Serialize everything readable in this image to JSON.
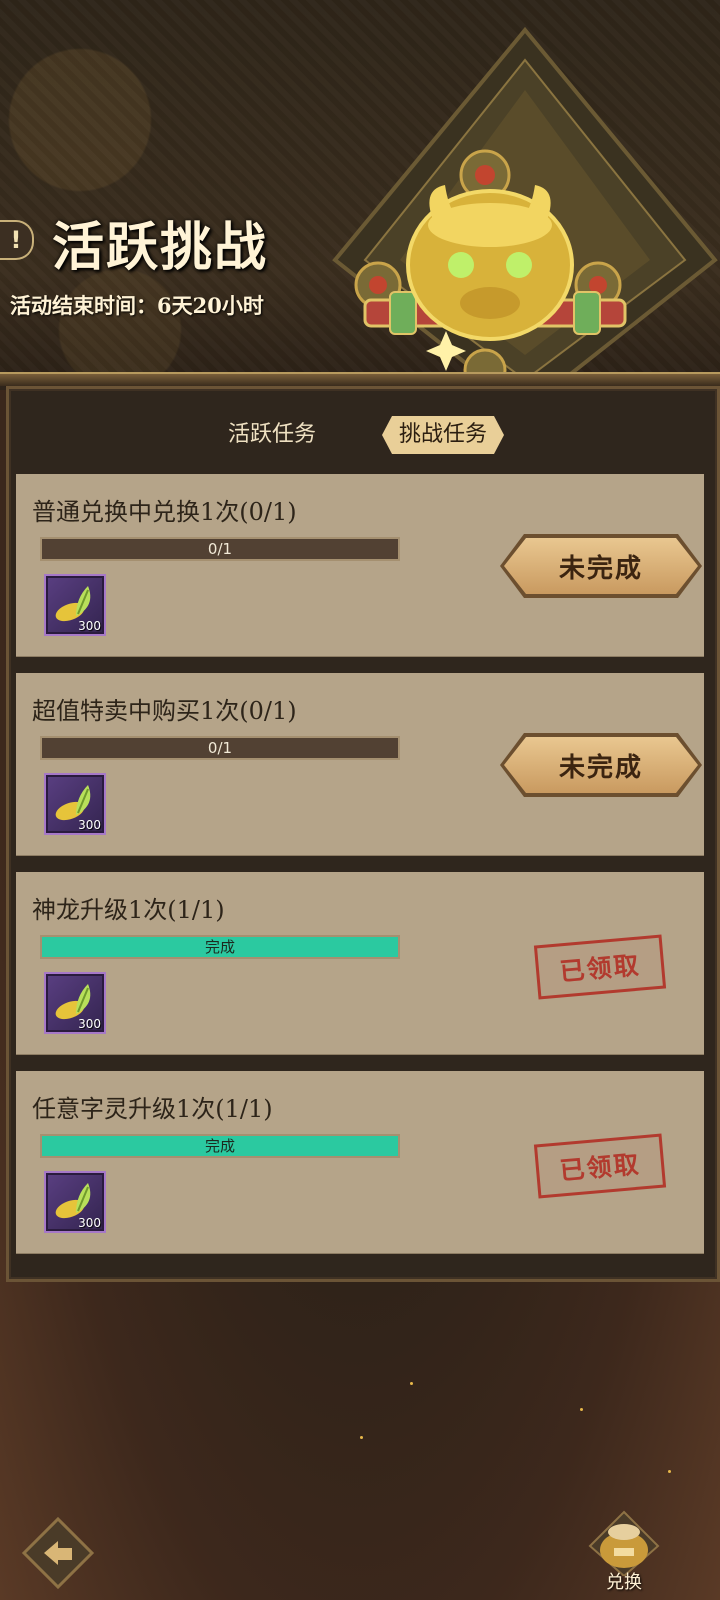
{
  "header": {
    "title": "活跃挑战",
    "countdown": "活动结束时间：6天20小时"
  },
  "tabs": [
    {
      "label": "活跃任务",
      "active": false
    },
    {
      "label": "挑战任务",
      "active": true
    }
  ],
  "tasks": [
    {
      "title": "普通兑换中兑换1次(0/1)",
      "progress_label": "0/1",
      "progress": 0,
      "reward_qty": "300",
      "status": "未完成"
    },
    {
      "title": "超值特卖中购买1次(0/1)",
      "progress_label": "0/1",
      "progress": 0,
      "reward_qty": "300",
      "status": "未完成"
    },
    {
      "title": "神龙升级1次(1/1)",
      "progress_label": "完成",
      "progress": 1,
      "reward_qty": "300",
      "status": "已领取"
    },
    {
      "title": "任意字灵升级1次(1/1)",
      "progress_label": "完成",
      "progress": 1,
      "reward_qty": "300",
      "status": "已领取"
    }
  ],
  "footer": {
    "exchange_label": "兑换"
  },
  "colors": {
    "card": "#b5a489",
    "progress_done": "#2bc9a0",
    "stamp_red": "#b23a2e"
  }
}
